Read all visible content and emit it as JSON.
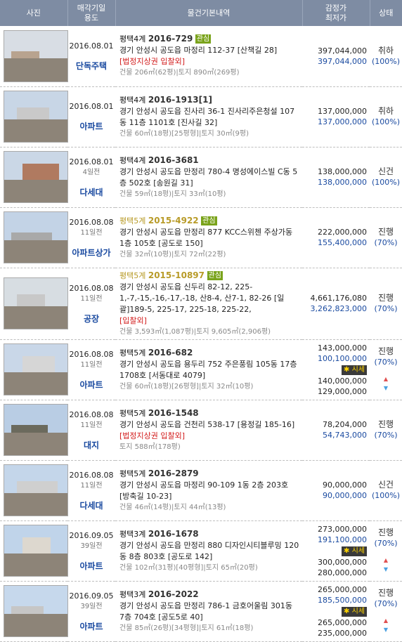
{
  "headers": {
    "photo": "사진",
    "date": "매각기일",
    "use": "용도",
    "info": "물건기본내역",
    "appr": "감정가",
    "min": "최저가",
    "status": "상태"
  },
  "rows": [
    {
      "date": "2016.08.01",
      "ago": "",
      "use": "단독주택",
      "court": "평택4계",
      "caseno": "2016-729",
      "badge": "관심",
      "addr": "경기 안성시 공도읍 마정리 112-37 [산책길 28]",
      "tags": "[법정지상권   입찰외]",
      "area": "건물 206㎡(62평)|토지 890㎡(269평)",
      "appr": "397,044,000",
      "min": "397,044,000",
      "market": "",
      "m1": "",
      "m2": "",
      "status": "취하",
      "pct": "(100%)",
      "dim": false
    },
    {
      "date": "2016.08.01",
      "ago": "",
      "use": "아파트",
      "court": "평택4계",
      "caseno": "2016-1913[1]",
      "badge": "",
      "addr": "경기 안성시 공도읍 진사리 36-1 진사리주은청설 107동 11층 1101호 [진사길 32]",
      "tags": "",
      "area": "건물 60㎡(18평)[25평형]|토지 30㎡(9평)",
      "appr": "137,000,000",
      "min": "137,000,000",
      "market": "",
      "m1": "",
      "m2": "",
      "status": "취하",
      "pct": "(100%)",
      "dim": false
    },
    {
      "date": "2016.08.01",
      "ago": "4일전",
      "use": "다세대",
      "court": "평택4계",
      "caseno": "2016-3681",
      "badge": "",
      "addr": "경기 안성시 공도읍 만정리 780-4 명성에이스빌 C동 5층 502호 [송원길 31]",
      "tags": "",
      "area": "건물 59㎡(18평)|토지 33㎡(10평)",
      "appr": "138,000,000",
      "min": "138,000,000",
      "market": "",
      "m1": "",
      "m2": "",
      "status": "신건",
      "pct": "(100%)",
      "dim": false
    },
    {
      "date": "2016.08.08",
      "ago": "11일전",
      "use": "아파트상가",
      "court": "평택5계",
      "caseno": "2015-4922",
      "badge": "관심",
      "addr": "경기 안성시 공도읍 만정리 877 KCC스위첸 주상가동 1층 105호 [공도로 150]",
      "tags": "",
      "area": "건물 32㎡(10평)|토지 72㎡(22평)",
      "appr": "222,000,000",
      "min": "155,400,000",
      "market": "",
      "m1": "",
      "m2": "",
      "status": "진행",
      "pct": "(70%)",
      "dim": true
    },
    {
      "date": "2016.08.08",
      "ago": "11일전",
      "use": "공장",
      "court": "평택5계",
      "caseno": "2015-10897",
      "badge": "관심",
      "addr": "경기 안성시 공도읍 신두리 82-12, 225-1,-7,-15,-16,-17,-18, 산8-4, 산7-1, 82-26 [일괄]189-5, 225-17, 225-18, 225-22,",
      "tags": "[입찰외]",
      "area": "건물 3,593㎡(1,087평)|토지 9,605㎡(2,906평)",
      "appr": "4,661,176,080",
      "min": "3,262,823,000",
      "market": "",
      "m1": "",
      "m2": "",
      "status": "진행",
      "pct": "(70%)",
      "dim": true
    },
    {
      "date": "2016.08.08",
      "ago": "11일전",
      "use": "아파트",
      "court": "평택5계",
      "caseno": "2016-682",
      "badge": "",
      "addr": "경기 안성시 공도읍 용두리 752 주은풍림 105동 17층 1708호 [서동대로 4079]",
      "tags": "",
      "area": "건물 60㎡(18평)[26평형]|토지 32㎡(10평)",
      "appr": "143,000,000",
      "min": "100,100,000",
      "market": "시세",
      "m1": "140,000,000",
      "m2": "129,000,000",
      "status": "진행",
      "pct": "(70%)",
      "dim": false
    },
    {
      "date": "2016.08.08",
      "ago": "11일전",
      "use": "대지",
      "court": "평택5계",
      "caseno": "2016-1548",
      "badge": "",
      "addr": "경기 안성시 공도읍 건천리 538-17 [용정길 185-16]",
      "tags": "[법정지상권   입찰외]",
      "area": "토지 588㎡(178평)",
      "appr": "78,204,000",
      "min": "54,743,000",
      "market": "",
      "m1": "",
      "m2": "",
      "status": "진행",
      "pct": "(70%)",
      "dim": false
    },
    {
      "date": "2016.08.08",
      "ago": "11일전",
      "use": "다세대",
      "court": "평택5계",
      "caseno": "2016-2879",
      "badge": "",
      "addr": "경기 안성시 공도읍 마정리 90-109 1동 2층 203호 [방축길 10-23]",
      "tags": "",
      "area": "건물 46㎡(14평)|토지 44㎡(13평)",
      "appr": "90,000,000",
      "min": "90,000,000",
      "market": "",
      "m1": "",
      "m2": "",
      "status": "신건",
      "pct": "(100%)",
      "dim": false
    },
    {
      "date": "2016.09.05",
      "ago": "39일전",
      "use": "아파트",
      "court": "평택3계",
      "caseno": "2016-1678",
      "badge": "",
      "addr": "경기 안성시 공도읍 만정리 880 디자인시티블루밍 120동 8층 803호 [공도로 142]",
      "tags": "",
      "area": "건물 102㎡(31평)[40평형]|토지 65㎡(20평)",
      "appr": "273,000,000",
      "min": "191,100,000",
      "market": "시세",
      "m1": "300,000,000",
      "m2": "280,000,000",
      "status": "진행",
      "pct": "(70%)",
      "dim": false
    },
    {
      "date": "2016.09.05",
      "ago": "39일전",
      "use": "아파트",
      "court": "평택3계",
      "caseno": "2016-2022",
      "badge": "",
      "addr": "경기 안성시 공도읍 만정리 786-1 금호어울림 301동 7층 704호 [공도5로 40]",
      "tags": "",
      "area": "건물 85㎡(26평)[34평형]|토지 61㎡(18평)",
      "appr": "265,000,000",
      "min": "185,500,000",
      "market": "시세",
      "m1": "265,000,000",
      "m2": "235,000,000",
      "status": "진행",
      "pct": "(70%)",
      "dim": false
    }
  ]
}
